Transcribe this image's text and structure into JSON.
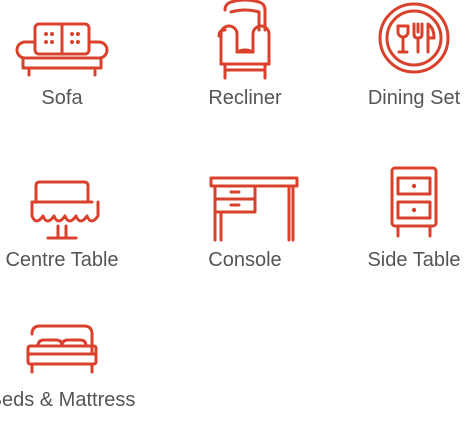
{
  "accent_color": "#d9412c",
  "label_color": "#555555",
  "categories": [
    {
      "label": "Sofa",
      "icon": "sofa-icon"
    },
    {
      "label": "Recliner",
      "icon": "recliner-icon"
    },
    {
      "label": "Dining Set",
      "icon": "dining-set-icon"
    },
    {
      "label": "Centre Table",
      "icon": "centre-table-icon"
    },
    {
      "label": "Console",
      "icon": "console-icon"
    },
    {
      "label": "Side Table",
      "icon": "side-table-icon"
    },
    {
      "label": "Beds & Mattress",
      "icon": "bed-icon"
    }
  ]
}
